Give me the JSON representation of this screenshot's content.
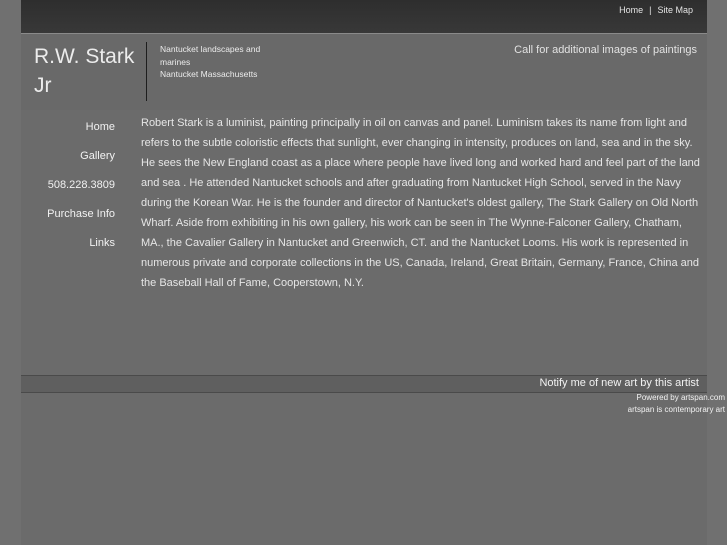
{
  "topnav": {
    "home": "Home",
    "separator": "|",
    "sitemap": "Site Map"
  },
  "header": {
    "title": "R.W. Stark Jr",
    "tagline_line1": "Nantucket landscapes and",
    "tagline_line2": "marines",
    "tagline_line3": "Nantucket Massachusetts",
    "call_text": "Call for additional images of paintings"
  },
  "sidebar": {
    "items": [
      {
        "label": "Home"
      },
      {
        "label": "Gallery"
      },
      {
        "label": "508.228.3809"
      },
      {
        "label": "Purchase Info"
      },
      {
        "label": "Links"
      }
    ]
  },
  "content": {
    "bio": "Robert Stark is a luminist, painting principally in oil on canvas and panel. Luminism takes its name from light and refers to the subtle coloristic effects that sunlight, ever changing in intensity, produces on land, sea and in the sky. He sees the New England coast as a place where people have lived long and worked hard and feel part of the land and sea . He attended Nantucket schools and after graduating from Nantucket High School, served in the Navy during the Korean War. He is the founder and director of Nantucket's oldest gallery, The Stark Gallery on Old North Wharf. Aside from exhibiting in his own gallery, his work can be seen in The Wynne-Falconer Gallery, Chatham, MA., the Cavalier Gallery in Nantucket and Greenwich, CT. and the Nantucket Looms. His work is represented in numerous private and corporate collections in the US, Canada, Ireland, Great Britain, Germany, France, China and the Baseball Hall of Fame, Cooperstown, N.Y."
  },
  "footer": {
    "notify": "Notify me of new art by this artist",
    "powered_by": "Powered by artspan.com",
    "artspan_tagline": "artspan is contemporary art"
  },
  "colors": {
    "page_bg": "#707070",
    "topbar_bg": "#333333",
    "text": "#ececec",
    "divider": "#1e1e1e"
  }
}
